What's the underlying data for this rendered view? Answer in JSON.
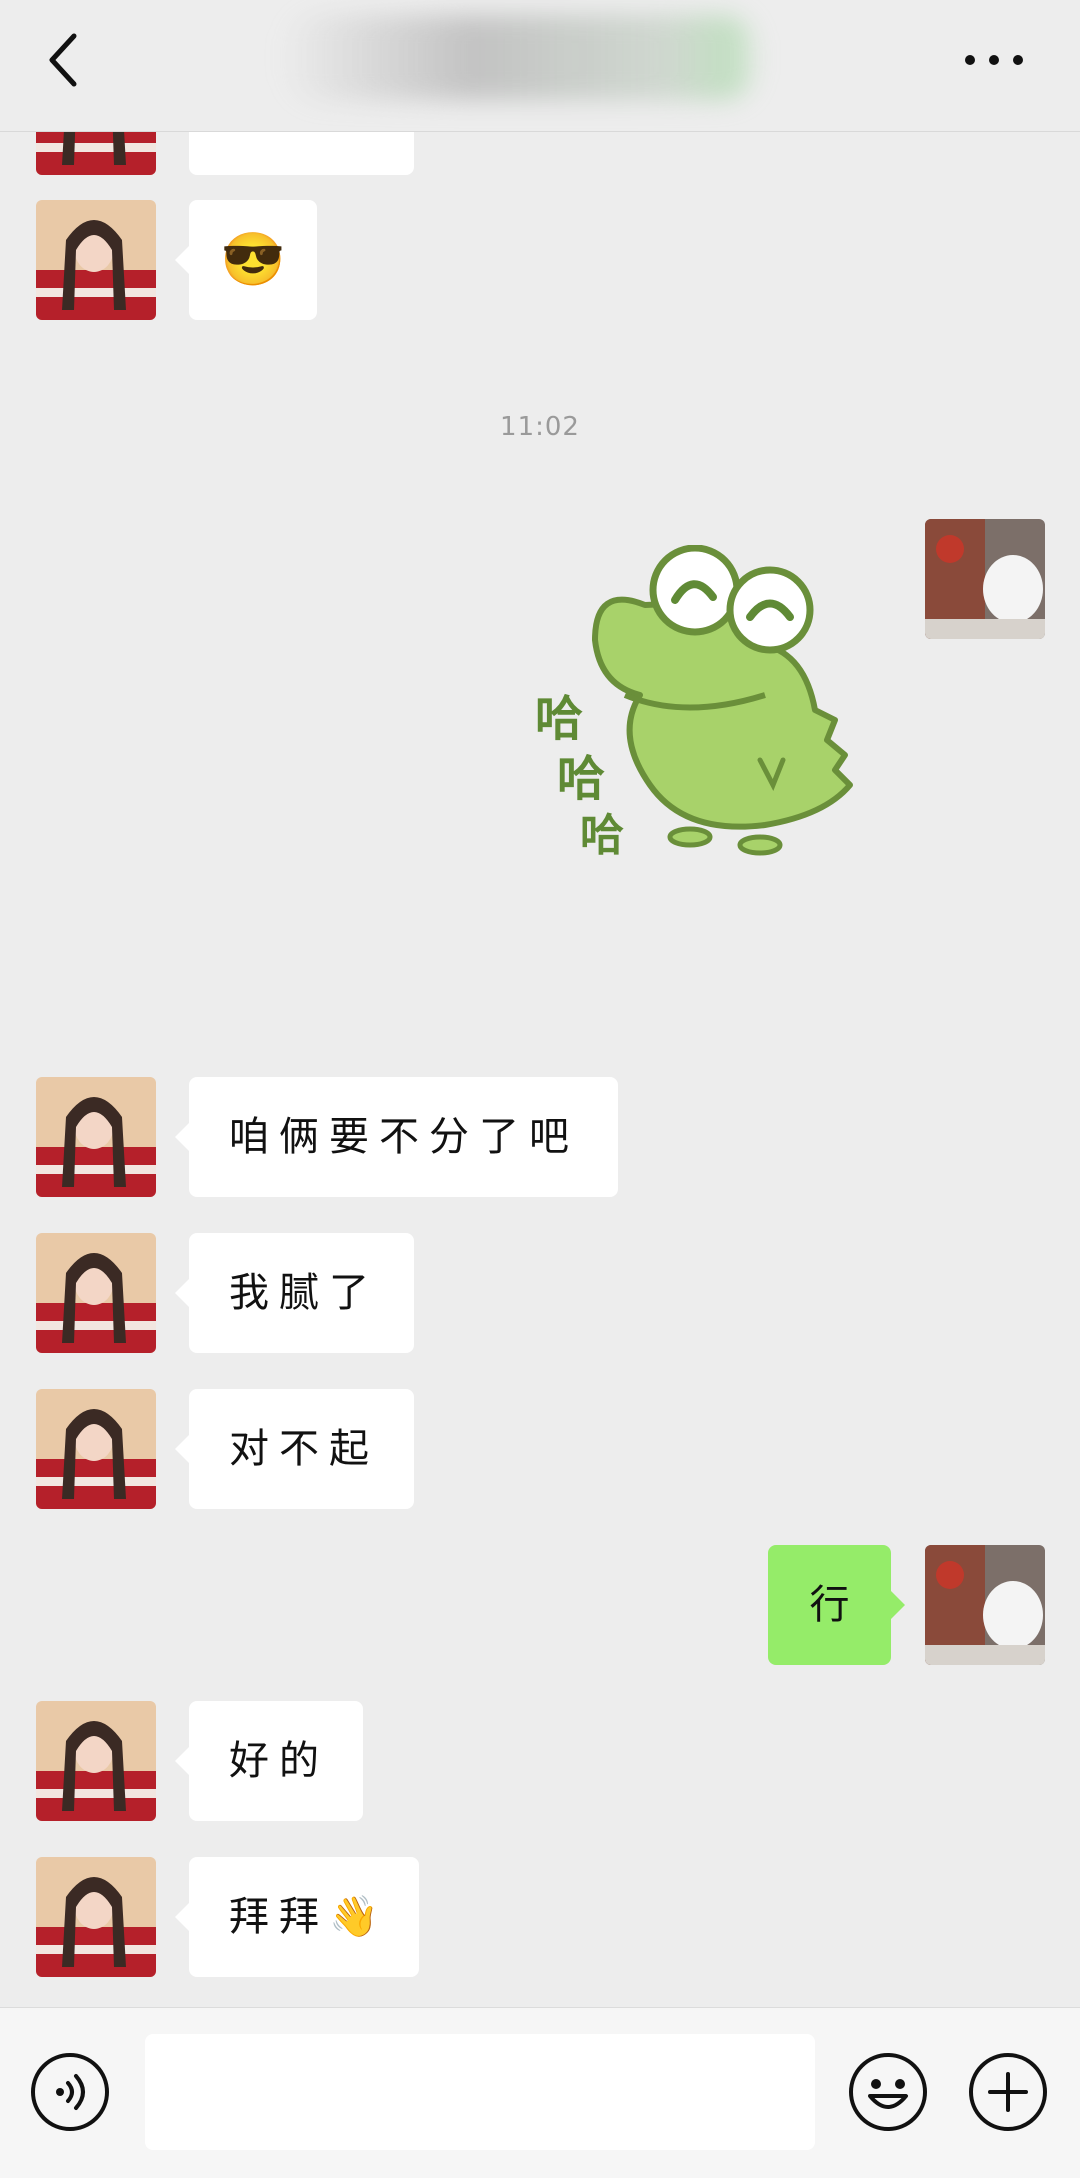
{
  "header": {
    "title": "",
    "back_icon": "chevron-left-icon",
    "more_icon": "more-icon"
  },
  "messages": {
    "timestamp": "11:02",
    "m1_emoji": "😎",
    "m4_text": "咱俩要不分了吧",
    "m5_text": "我腻了",
    "m6_text": "对不起",
    "m7_text": "行",
    "m8_text": "好的",
    "m9_text": "拜拜👋",
    "sticker_text": [
      "哈",
      "哈",
      "哈"
    ]
  },
  "input_bar": {
    "value": "",
    "voice_icon": "voice-icon",
    "emoji_icon": "emoji-icon",
    "plus_icon": "plus-icon"
  },
  "colors": {
    "background": "#ededed",
    "bubble_self": "#95ec69",
    "bubble_other": "#ffffff"
  }
}
